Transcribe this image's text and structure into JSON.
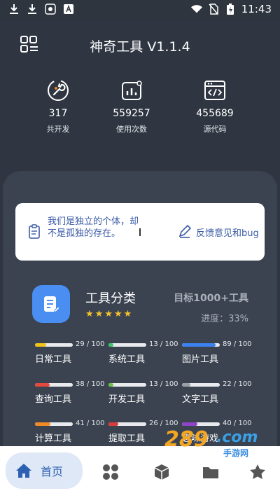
{
  "status_bar": {
    "time": "11:43",
    "colors": {
      "bg": "#2e353f"
    }
  },
  "header": {
    "title": "神奇工具 V1.1.4"
  },
  "stats": [
    {
      "value": "317",
      "label": "共开发",
      "icon": "wrench-icon"
    },
    {
      "value": "559257",
      "label": "使用次数",
      "icon": "chart-icon"
    },
    {
      "value": "455689",
      "label": "源代码",
      "icon": "code-window-icon"
    }
  ],
  "notice": {
    "text": "我们是独立的个体，却不是孤独的存在。",
    "feedback_label": "反馈意见和bug"
  },
  "category": {
    "title": "工具分类",
    "goal": "目标1000+工具",
    "progress": "进度：33%",
    "stars": 5
  },
  "tools": [
    {
      "name": "日常工具",
      "count": "29 / 100",
      "fraction": 0.29,
      "color": "#f0c419"
    },
    {
      "name": "系统工具",
      "count": "13 / 100",
      "fraction": 0.13,
      "color": "#3ec36a"
    },
    {
      "name": "图片工具",
      "count": "89 / 100",
      "fraction": 0.89,
      "color": "#3b82f0"
    },
    {
      "name": "查询工具",
      "count": "38 / 100",
      "fraction": 0.38,
      "color": "#e5483c"
    },
    {
      "name": "开发工具",
      "count": "13 / 100",
      "fraction": 0.13,
      "color": "#6cc04a"
    },
    {
      "name": "文字工具",
      "count": "22 / 100",
      "fraction": 0.22,
      "color": "#9a9fa6"
    },
    {
      "name": "计算工具",
      "count": "41 / 100",
      "fraction": 0.41,
      "color": "#f08a24"
    },
    {
      "name": "提取工具",
      "count": "26 / 100",
      "fraction": 0.26,
      "color": "#d93a3a"
    },
    {
      "name": "趣味游戏",
      "count": "40 / 100",
      "fraction": 0.4,
      "color": "#8e44c9"
    }
  ],
  "bottom_nav": {
    "home_label": "首页"
  },
  "watermark": {
    "number": "289",
    "domain": ".com",
    "text": "手游网"
  }
}
